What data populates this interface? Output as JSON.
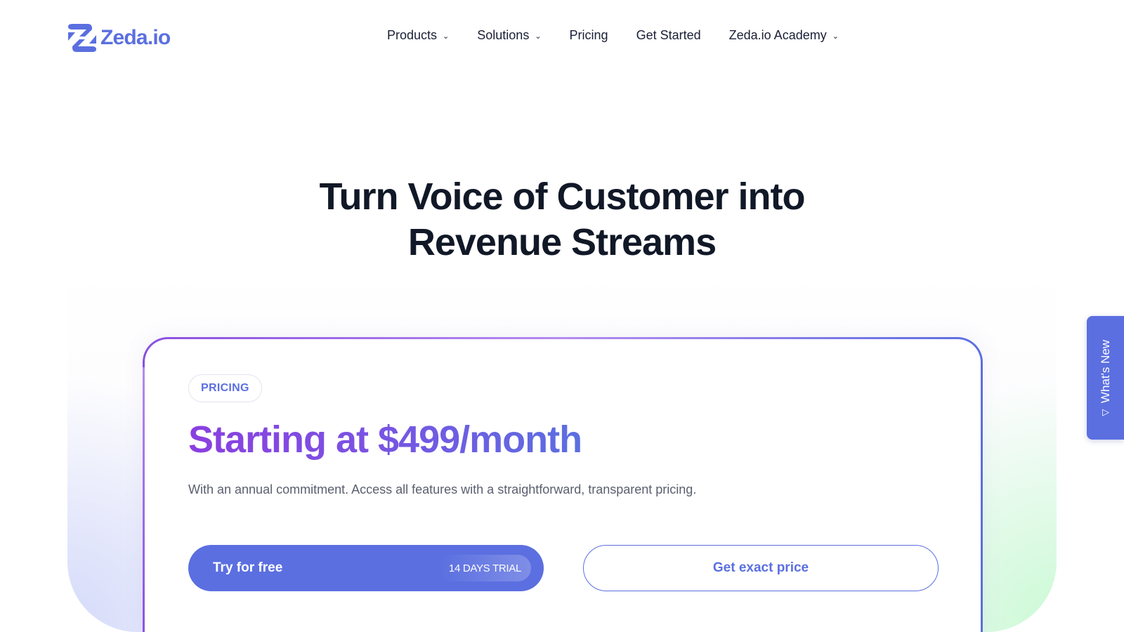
{
  "brand": {
    "name": "Zeda.io",
    "color": "#5b6fe0"
  },
  "nav": {
    "items": [
      {
        "label": "Products",
        "has_dropdown": true
      },
      {
        "label": "Solutions",
        "has_dropdown": true
      },
      {
        "label": "Pricing",
        "has_dropdown": false
      },
      {
        "label": "Get Started",
        "has_dropdown": false
      },
      {
        "label": "Zeda.io Academy",
        "has_dropdown": true
      }
    ]
  },
  "hero": {
    "title_line1": "Turn Voice of Customer into",
    "title_line2": "Revenue Streams"
  },
  "pricing_card": {
    "tag": "PRICING",
    "price_heading": "Starting at $499/month",
    "description": "With an annual commitment. Access all features with a straightforward, transparent pricing.",
    "primary_button": {
      "label": "Try for free",
      "badge": "14 DAYS TRIAL"
    },
    "secondary_button": {
      "label": "Get exact price"
    }
  },
  "whats_new": {
    "label": "What's New",
    "icon": "triangle-up-icon"
  },
  "colors": {
    "accent": "#5b6fe0",
    "purple": "#8b3fe0",
    "heading": "#111827",
    "body_text": "#5a5f6e"
  }
}
